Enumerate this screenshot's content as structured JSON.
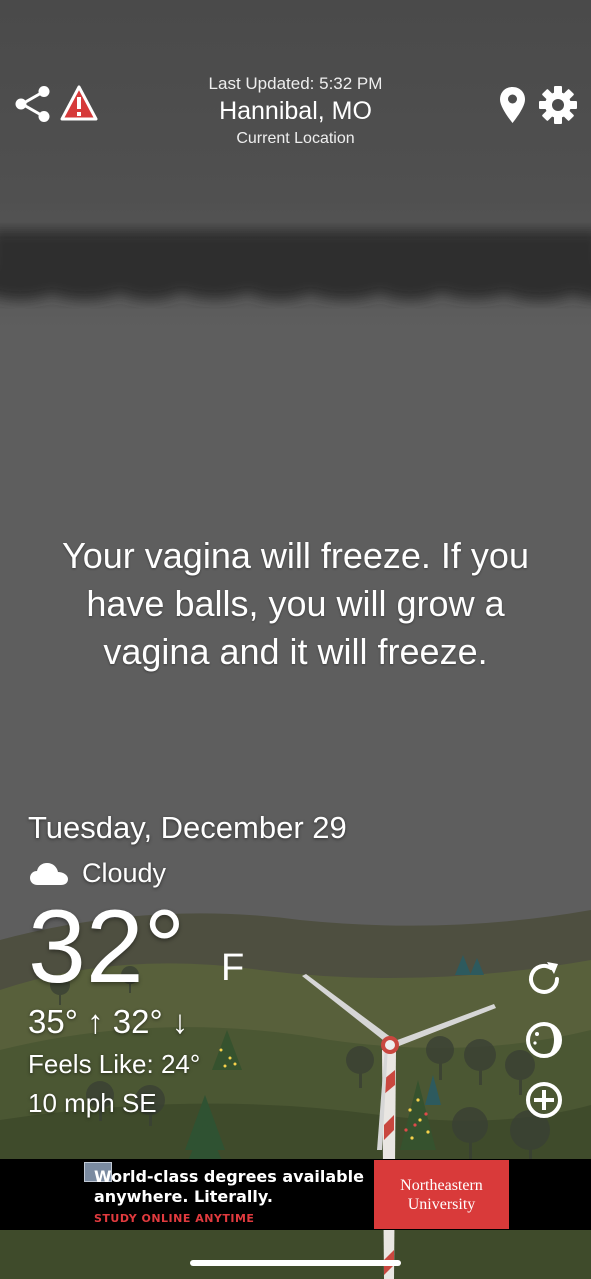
{
  "header": {
    "last_updated": "Last Updated: 5:32 PM",
    "city": "Hannibal, MO",
    "location_label": "Current Location"
  },
  "message": "Your vagina will freeze. If you have balls, you will grow a vagina and it will freeze.",
  "weather": {
    "date": "Tuesday, December 29",
    "condition": "Cloudy",
    "temperature": "32°",
    "unit": "F",
    "high_low": "35° ↑  32° ↓",
    "feels_like": "Feels Like: 24°",
    "wind": "10 mph SE"
  },
  "ad": {
    "line1": "World-class degrees available",
    "line2": "anywhere. Literally.",
    "cta": "STUDY ONLINE ANYTIME",
    "brand_line1": "Northeastern",
    "brand_line2": "University"
  },
  "icons": {
    "share": "share-icon",
    "alert": "warning-triangle-icon",
    "location": "location-pin-icon",
    "settings": "gear-icon",
    "condition": "cloud-icon",
    "refresh": "refresh-icon",
    "moon": "moon-icon",
    "add": "plus-circle-icon"
  },
  "colors": {
    "alert_red": "#d63a3a",
    "ad_brand_red": "#d93a3a",
    "ad_cta_red": "#e03a3e"
  }
}
